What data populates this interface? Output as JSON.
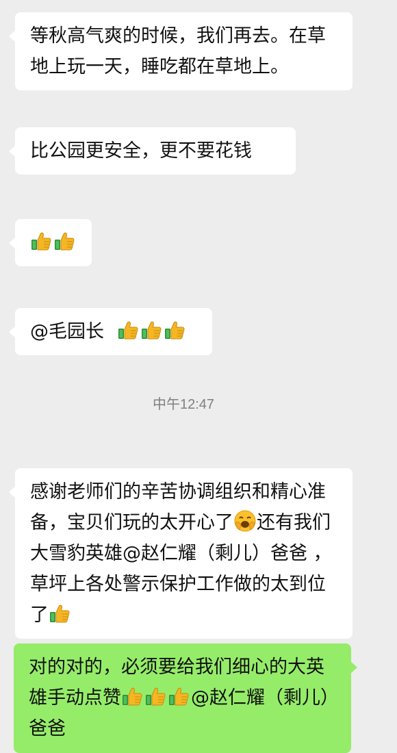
{
  "messages": [
    {
      "text": "等秋高气爽的时候，我们再去。在草地上玩一天，睡吃都在草地上。"
    },
    {
      "text": "比公园更安全，更不要花钱"
    },
    {
      "emoji": "thumbs-up-icon",
      "emoji_count": 2
    },
    {
      "text": "@毛园长",
      "emoji": "thumbs-up-icon",
      "emoji_count": 3
    },
    {
      "text_a": "感谢老师们的辛苦协调组织和精心准备，宝贝们玩的太开心了",
      "emoji_a": "laughing-face-icon",
      "text_b": "还有我们大雪豹英雄@赵仁耀（剩儿）爸爸 ，草坪上各处警示保护工作做的太到位了",
      "emoji_b": "thumbs-up-icon"
    },
    {
      "text_a": "对的对的，必须要给我们细心的大英雄手动点赞",
      "emoji": "thumbs-up-icon",
      "emoji_count": 3,
      "text_b": "@赵仁耀（剩儿）爸爸"
    }
  ],
  "timestamp": "中午12:47",
  "colors": {
    "background": "#ededed",
    "incoming_bubble": "#ffffff",
    "outgoing_bubble": "#95ec69",
    "timestamp_text": "#7f7f7f"
  }
}
